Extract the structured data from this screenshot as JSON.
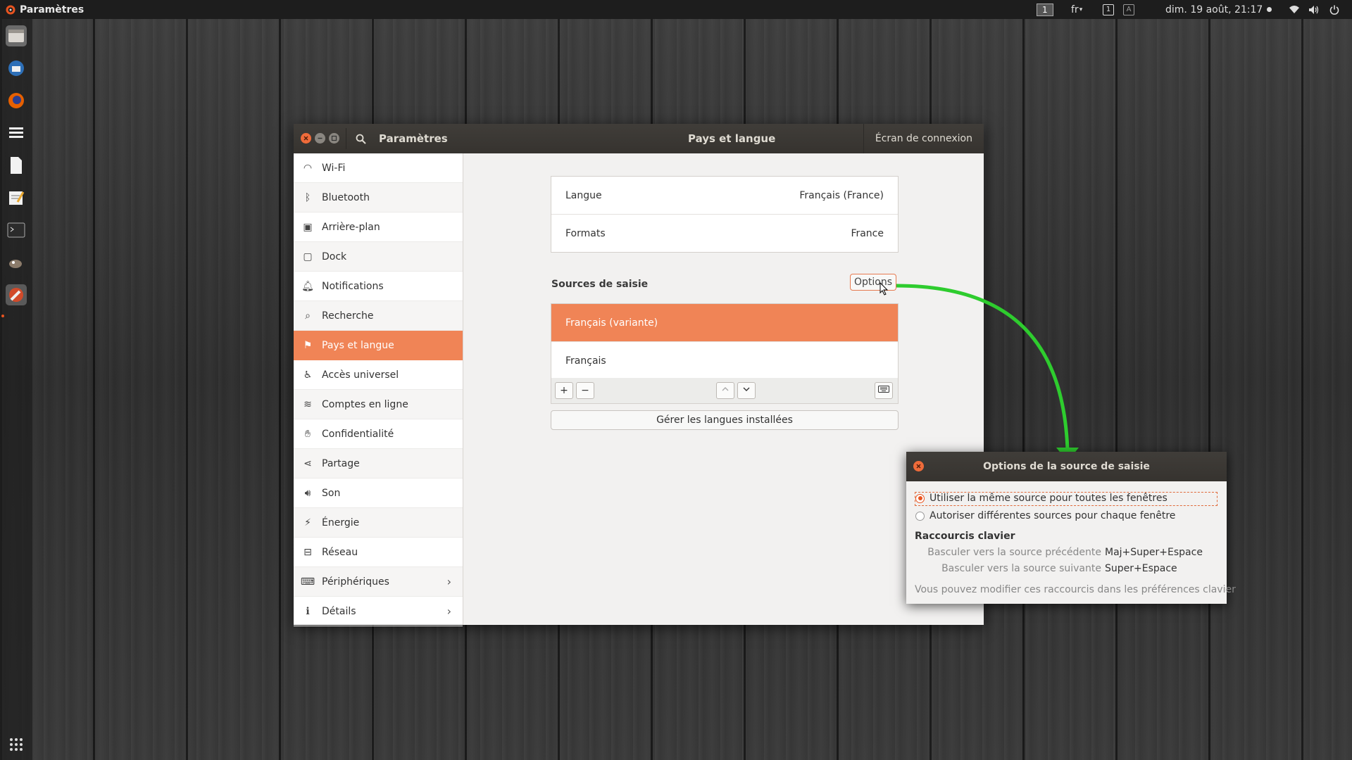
{
  "topbar": {
    "app_name": "Paramètres",
    "workspace": "1",
    "keyboard_layout": "fr",
    "datetime": "dim. 19 août, 21:17"
  },
  "dock": {
    "items": [
      "files-icon",
      "thunderbird-icon",
      "firefox-icon",
      "tasks-icon",
      "document-icon",
      "text-editor-icon",
      "terminal-icon",
      "gimp-icon",
      "settings-icon"
    ],
    "apps_grid_icon": "apps-grid-icon"
  },
  "window": {
    "left_title": "Paramètres",
    "title": "Pays et langue",
    "login_screen_button": "Écran de connexion"
  },
  "sidebar": {
    "items": [
      {
        "label": "Wi-Fi",
        "icon": "wifi-icon"
      },
      {
        "label": "Bluetooth",
        "icon": "bluetooth-icon"
      },
      {
        "label": "Arrière-plan",
        "icon": "background-icon"
      },
      {
        "label": "Dock",
        "icon": "dock-icon"
      },
      {
        "label": "Notifications",
        "icon": "bell-icon"
      },
      {
        "label": "Recherche",
        "icon": "search-icon"
      },
      {
        "label": "Pays et langue",
        "icon": "flag-icon"
      },
      {
        "label": "Accès universel",
        "icon": "accessibility-icon"
      },
      {
        "label": "Comptes en ligne",
        "icon": "online-accounts-icon"
      },
      {
        "label": "Confidentialité",
        "icon": "privacy-hand-icon"
      },
      {
        "label": "Partage",
        "icon": "share-icon"
      },
      {
        "label": "Son",
        "icon": "speaker-icon"
      },
      {
        "label": "Énergie",
        "icon": "power-icon"
      },
      {
        "label": "Réseau",
        "icon": "network-icon"
      },
      {
        "label": "Périphériques",
        "icon": "devices-icon"
      },
      {
        "label": "Détails",
        "icon": "info-icon"
      }
    ]
  },
  "region": {
    "language_label": "Langue",
    "language_value": "Français (France)",
    "formats_label": "Formats",
    "formats_value": "France",
    "input_sources_title": "Sources de saisie",
    "options_button": "Options",
    "sources": [
      "Français (variante)",
      "Français"
    ],
    "add_symbol": "+",
    "remove_symbol": "−",
    "manage_languages_button": "Gérer les langues installées"
  },
  "dialog": {
    "title": "Options de la source de saisie",
    "radio_same": "Utiliser la même source pour toutes les fenêtres",
    "radio_different": "Autoriser différentes sources pour chaque fenêtre",
    "shortcuts_title": "Raccourcis clavier",
    "prev_label": "Basculer vers la source précédente",
    "prev_value": "Maj+Super+Espace",
    "next_label": "Basculer vers la source suivante",
    "next_value": "Super+Espace",
    "footer_note": "Vous pouvez modifier ces raccourcis dans les préférences clavier"
  },
  "colors": {
    "accent": "#f08456",
    "arrow": "#2ecc2e",
    "ubuntu_orange": "#e95420"
  }
}
